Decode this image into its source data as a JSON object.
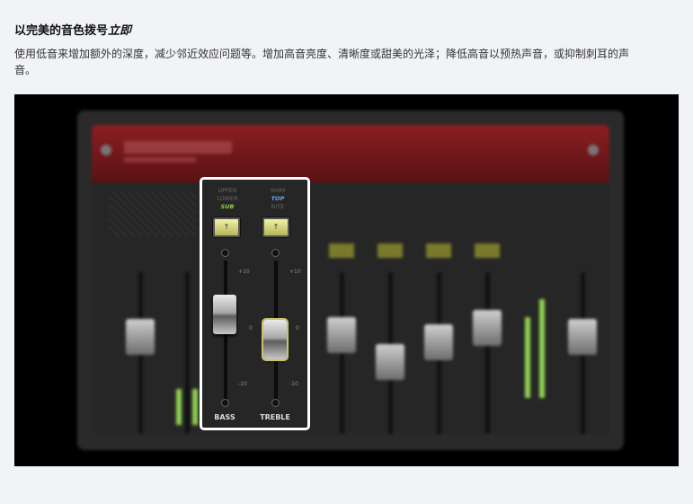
{
  "heading": {
    "text": "以完美的音色拨号",
    "italic": "立即"
  },
  "description": "使用低音来增加额外的深度，减少邻近效应问题等。增加高音亮度、清晰度或甜美的光泽；降低高音以预热声音，或抑制刺耳的声音。",
  "panel": {
    "bass": {
      "name": "BASS",
      "options": [
        "UPPER",
        "LOWER",
        "SUB"
      ],
      "selected": "SUB",
      "button_glyph": "↑",
      "level_db": 2
    },
    "treble": {
      "name": "TREBLE",
      "options": [
        "SHIM",
        "TOP",
        "BITE"
      ],
      "selected": "TOP",
      "button_glyph": "↑",
      "level_db": -1
    },
    "scale": {
      "top": "+10",
      "mid": "0",
      "bottom": "-10"
    }
  },
  "colors": {
    "page_bg": "#f1f3f6",
    "figure_bg": "#000000",
    "highlight_border": "#ffffff",
    "sub_active": "#8fd14f",
    "top_active": "#6aa7e0",
    "header_red": "#7a1a1d"
  }
}
